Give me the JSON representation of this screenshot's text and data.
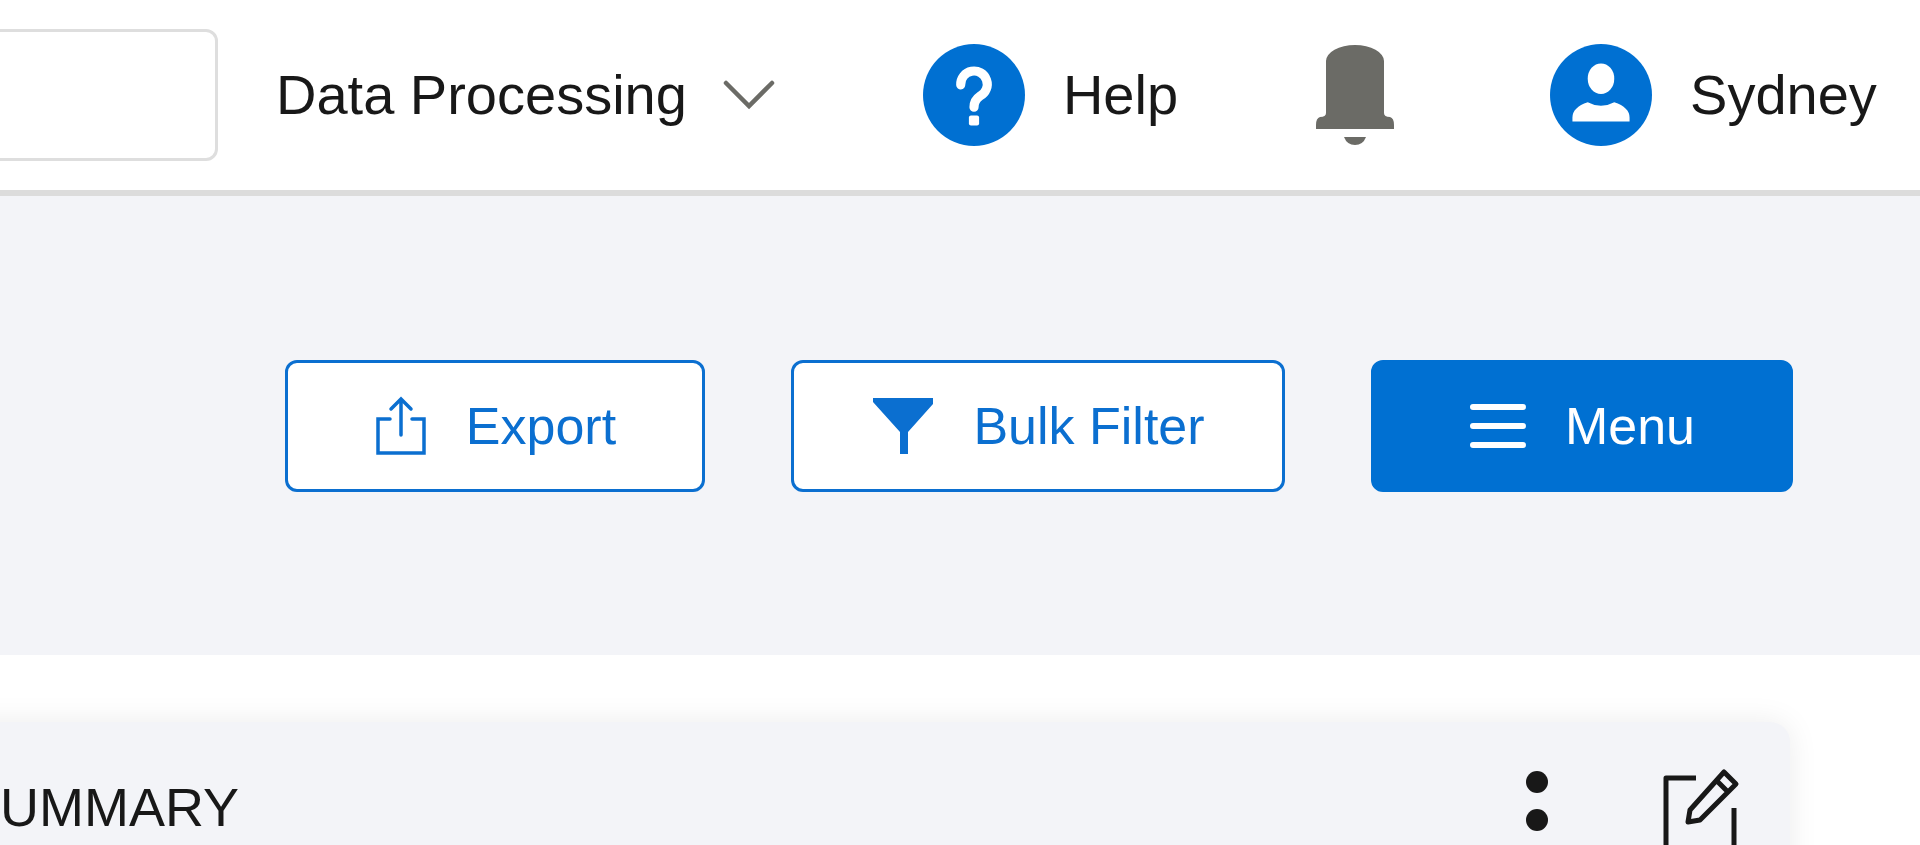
{
  "header": {
    "app_switcher": {
      "label": "Data Processing"
    },
    "help": {
      "label": "Help"
    },
    "user": {
      "name": "Sydney"
    }
  },
  "actions": [
    {
      "kind": "export",
      "label": "Export",
      "primary": false
    },
    {
      "kind": "filter",
      "label": "Bulk Filter",
      "primary": false
    },
    {
      "kind": "menu",
      "label": "Menu",
      "primary": true
    }
  ],
  "card": {
    "title": "UMMARY"
  }
}
